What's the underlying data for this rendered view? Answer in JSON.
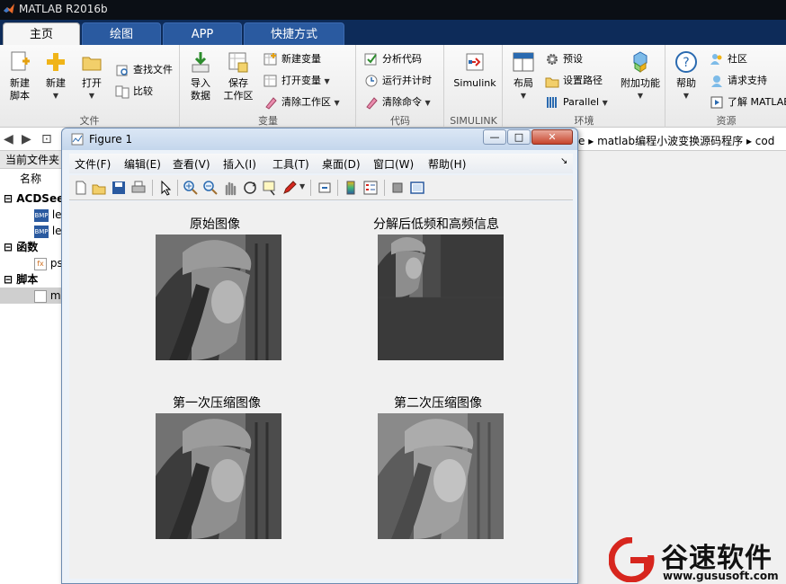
{
  "window": {
    "title": "MATLAB R2016b"
  },
  "tabs": [
    {
      "label": "主页",
      "active": true
    },
    {
      "label": "绘图",
      "active": false
    },
    {
      "label": "APP",
      "active": false
    },
    {
      "label": "快捷方式",
      "active": false
    }
  ],
  "ribbon": {
    "file": {
      "section_label": "文件",
      "new_script_l1": "新建",
      "new_script_l2": "脚本",
      "new_label": "新建",
      "open_label": "打开",
      "find_files": "查找文件",
      "compare": "比较"
    },
    "variable": {
      "section_label": "变量",
      "import_l1": "导入",
      "import_l2": "数据",
      "save_l1": "保存",
      "save_l2": "工作区",
      "new_variable": "新建变量",
      "open_variable": "打开变量",
      "clear_workspace": "清除工作区"
    },
    "code": {
      "section_label": "代码",
      "analyze": "分析代码",
      "run_time": "运行并计时",
      "clear_commands": "清除命令"
    },
    "simulink": {
      "section_label": "SIMULINK",
      "label": "Simulink"
    },
    "env": {
      "section_label": "环境",
      "layout": "布局",
      "preferences": "预设",
      "set_path": "设置路径",
      "parallel": "Parallel",
      "addons": "附加功能"
    },
    "resources": {
      "section_label": "资源",
      "help": "帮助",
      "community": "社区",
      "request_support": "请求支持",
      "learn": "了解 MATLAB"
    }
  },
  "address": {
    "crumb1": "e",
    "crumb2": "matlab编程小波变换源码程序",
    "crumb3": "cod"
  },
  "left_panel": {
    "header": "当前文件夹",
    "col_name": "名称",
    "group1": "ACDSee",
    "g1_item1": "le",
    "g1_item2": "le",
    "group2": "函数",
    "g2_item1": "ps",
    "group3": "脚本",
    "g3_item1": "m"
  },
  "figure": {
    "title": "Figure 1",
    "menus": [
      "文件(F)",
      "编辑(E)",
      "查看(V)",
      "插入(I)",
      "工具(T)",
      "桌面(D)",
      "窗口(W)",
      "帮助(H)"
    ],
    "plots": {
      "p1": "原始图像",
      "p2": "分解后低频和高频信息",
      "p3": "第一次压缩图像",
      "p4": "第二次压缩图像"
    }
  },
  "watermark": {
    "brand": "谷速软件",
    "url": "www.gususoft.com"
  },
  "colors": {
    "ribbon_tab_bar": "#0d2b59",
    "tab_active": "#f5f5f5",
    "brand_red": "#d7261e"
  }
}
